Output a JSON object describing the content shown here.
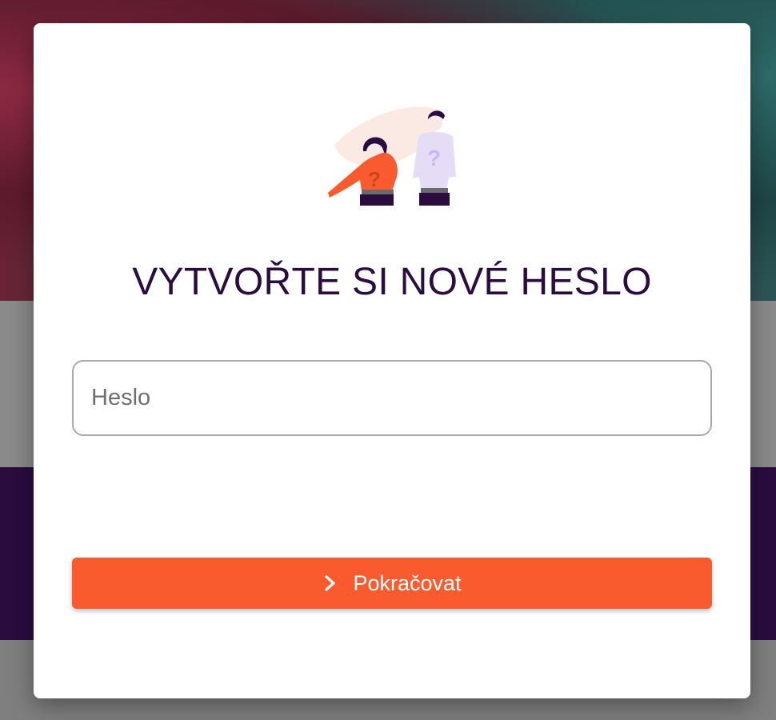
{
  "modal": {
    "title": "VYTVOŘTE SI NOVÉ HESLO",
    "illustration": "confused-couple-illustration",
    "password_field": {
      "placeholder": "Heslo",
      "value": ""
    },
    "continue_button": {
      "label": "Pokračovat",
      "icon": "chevron-right-icon"
    }
  },
  "colors": {
    "accent": "#f95b2e",
    "title": "#2a0c3f",
    "purple_band": "#2a0c3f"
  }
}
